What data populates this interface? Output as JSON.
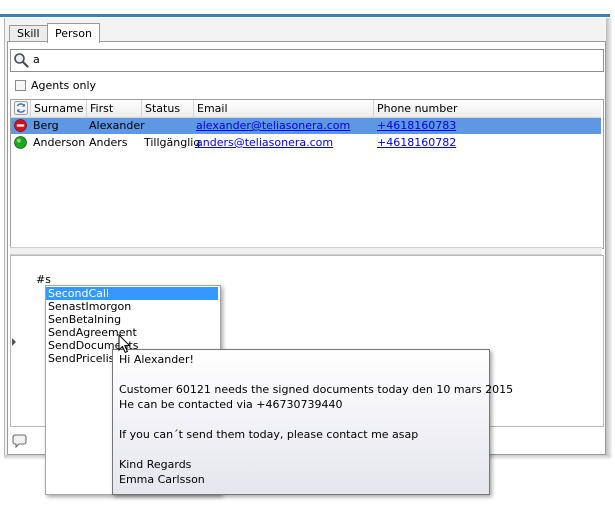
{
  "tabs": [
    {
      "label": "Skill",
      "active": false
    },
    {
      "label": "Person",
      "active": true
    }
  ],
  "search": {
    "value": "a",
    "icon": "magnifier-icon"
  },
  "agents_only": {
    "label": "Agents only",
    "checked": false
  },
  "table": {
    "columns": [
      "Surname",
      "First name",
      "Status",
      "Email",
      "Phone number"
    ],
    "rows": [
      {
        "status_icon": "unavailable-red-icon",
        "surname": "Berg",
        "first_name": "Alexander",
        "status": "",
        "email": "alexander@teliasonera.com",
        "phone": "+4618160783",
        "selected": true
      },
      {
        "status_icon": "available-green-icon",
        "surname": "Anderson",
        "first_name": "Anders",
        "status": "Tillgänglig",
        "email": "anders@teliasonera.com",
        "phone": "+4618160782",
        "selected": false
      }
    ]
  },
  "chat": {
    "input_text": "#s"
  },
  "suggestions": {
    "items": [
      "SecondCall",
      "SenastImorgon",
      "SenBetalning",
      "SendAgreement",
      "SendDocuments",
      "SendPricelist"
    ],
    "selected_index": 0
  },
  "tooltip": {
    "lines": [
      "Hi Alexander!",
      "",
      "Customer 60121 needs the signed documents today den 10 mars 2015",
      "He can be contacted via +46730739440",
      "",
      "If you can´t send them today, please contact me asap",
      "",
      "Kind Regards",
      "Emma Carlsson"
    ]
  },
  "colors": {
    "selection": "#5e97e3",
    "list_selection": "#3399ff",
    "link": "#0000ee",
    "status_red": "#d0121a",
    "status_green": "#1fa61f"
  }
}
